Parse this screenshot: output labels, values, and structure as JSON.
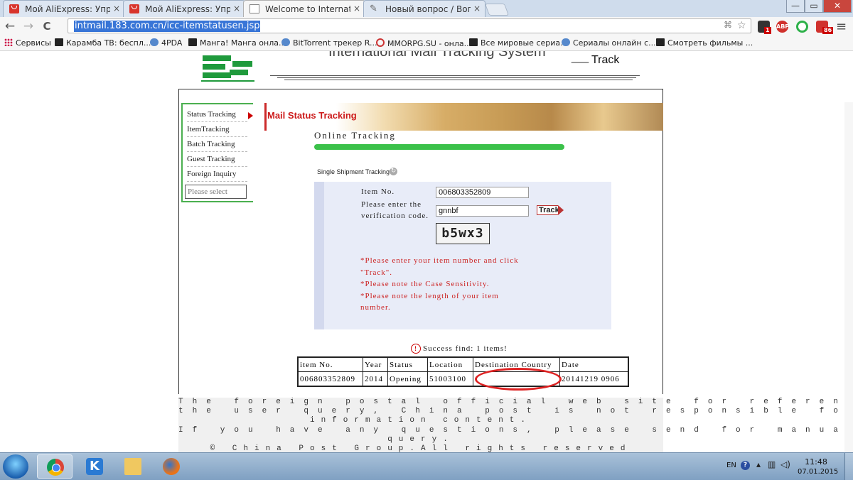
{
  "browser": {
    "tabs": [
      {
        "title": "Мой AliExpress: Управлят",
        "icon": "aliexpress-icon",
        "close": "×"
      },
      {
        "title": "Мой AliExpress: Управлят",
        "icon": "aliexpress-icon",
        "close": "×"
      },
      {
        "title": "Welcome to International",
        "icon": "document-icon",
        "close": "×"
      },
      {
        "title": "Новый вопрос / Вопрос",
        "icon": "quill-icon",
        "close": "×"
      }
    ],
    "window_controls": {
      "minimize": "—",
      "maximize": "▭",
      "close": "✕"
    },
    "nav": {
      "back": "←",
      "forward": "→",
      "reload": "C"
    },
    "url": "intmail.183.com.cn/icc-itemstatusen.jsp",
    "extensions": [
      {
        "name": "extension-icon",
        "badge": "1"
      },
      {
        "name": "adblock-plus-icon",
        "label": "ABP"
      },
      {
        "name": "green-circle-icon"
      },
      {
        "name": "extension-red-icon",
        "badge": "86"
      }
    ],
    "bookmarks": [
      {
        "label": "Сервисы",
        "icon": "apps-grid-icon"
      },
      {
        "label": "Карамба ТВ: беспл...",
        "icon": "film-icon"
      },
      {
        "label": "4PDA",
        "icon": "4pda-icon"
      },
      {
        "label": "Манга! Манга онла...",
        "icon": "manga-icon"
      },
      {
        "label": "BitTorrent трекер R...",
        "icon": "torrent-icon"
      },
      {
        "label": "MMORPG.SU - онла...",
        "icon": "mmorpg-icon"
      },
      {
        "label": "Все мировые сериа...",
        "icon": "film-icon"
      },
      {
        "label": "Сериалы онлайн с...",
        "icon": "plane-icon"
      },
      {
        "label": "Смотреть фильмы ...",
        "icon": "film-icon"
      }
    ]
  },
  "page": {
    "header": {
      "system_title": "International Mail Tracking System",
      "dash": "——",
      "subtitle": "Track"
    },
    "sidebar": {
      "items": [
        {
          "label": "Status Tracking"
        },
        {
          "label": "ItemTracking"
        },
        {
          "label": "Batch Tracking"
        },
        {
          "label": "Guest Tracking"
        },
        {
          "label": "Foreign Inquiry"
        }
      ],
      "select_placeholder": "Please select"
    },
    "banner_title": "Mail Status Tracking",
    "online_title": "Online Tracking",
    "single_shipment": "Single Shipment Tracking",
    "form": {
      "item_label": "Item No.",
      "item_value": "006803352809",
      "verify_label": "Please enter the verification code.",
      "verify_value": "gnnbf",
      "track_button": "Track",
      "captcha_text": "b5wx3",
      "notes": [
        "*Please enter your item number and click \"Track\".",
        "*Please note the Case Sensitivity.",
        "*Please note the length of your item number."
      ]
    },
    "success_text": "Success find: 1 items!",
    "results": {
      "columns": [
        "item No.",
        "Year",
        "Status",
        "Location",
        "Destination Country",
        "Date"
      ],
      "rows": [
        [
          "006803352809",
          "2014",
          "Opening",
          "51003100",
          "",
          "20141219 0906"
        ]
      ]
    },
    "footer": {
      "line1": "The foreign postal official web site for reference of",
      "line2": "the user query, China post is not responsible for the",
      "line3": "information content.",
      "line4": "If you have any questions, please send for manual",
      "line5": "query.",
      "line6": "© China Post Group.All rights reserved"
    }
  },
  "taskbar": {
    "apps": [
      "chrome-icon",
      "k-app-icon",
      "folder-icon",
      "firefox-icon"
    ],
    "tray_lang": "EN",
    "time": "11:48",
    "date": "07.01.2015"
  }
}
